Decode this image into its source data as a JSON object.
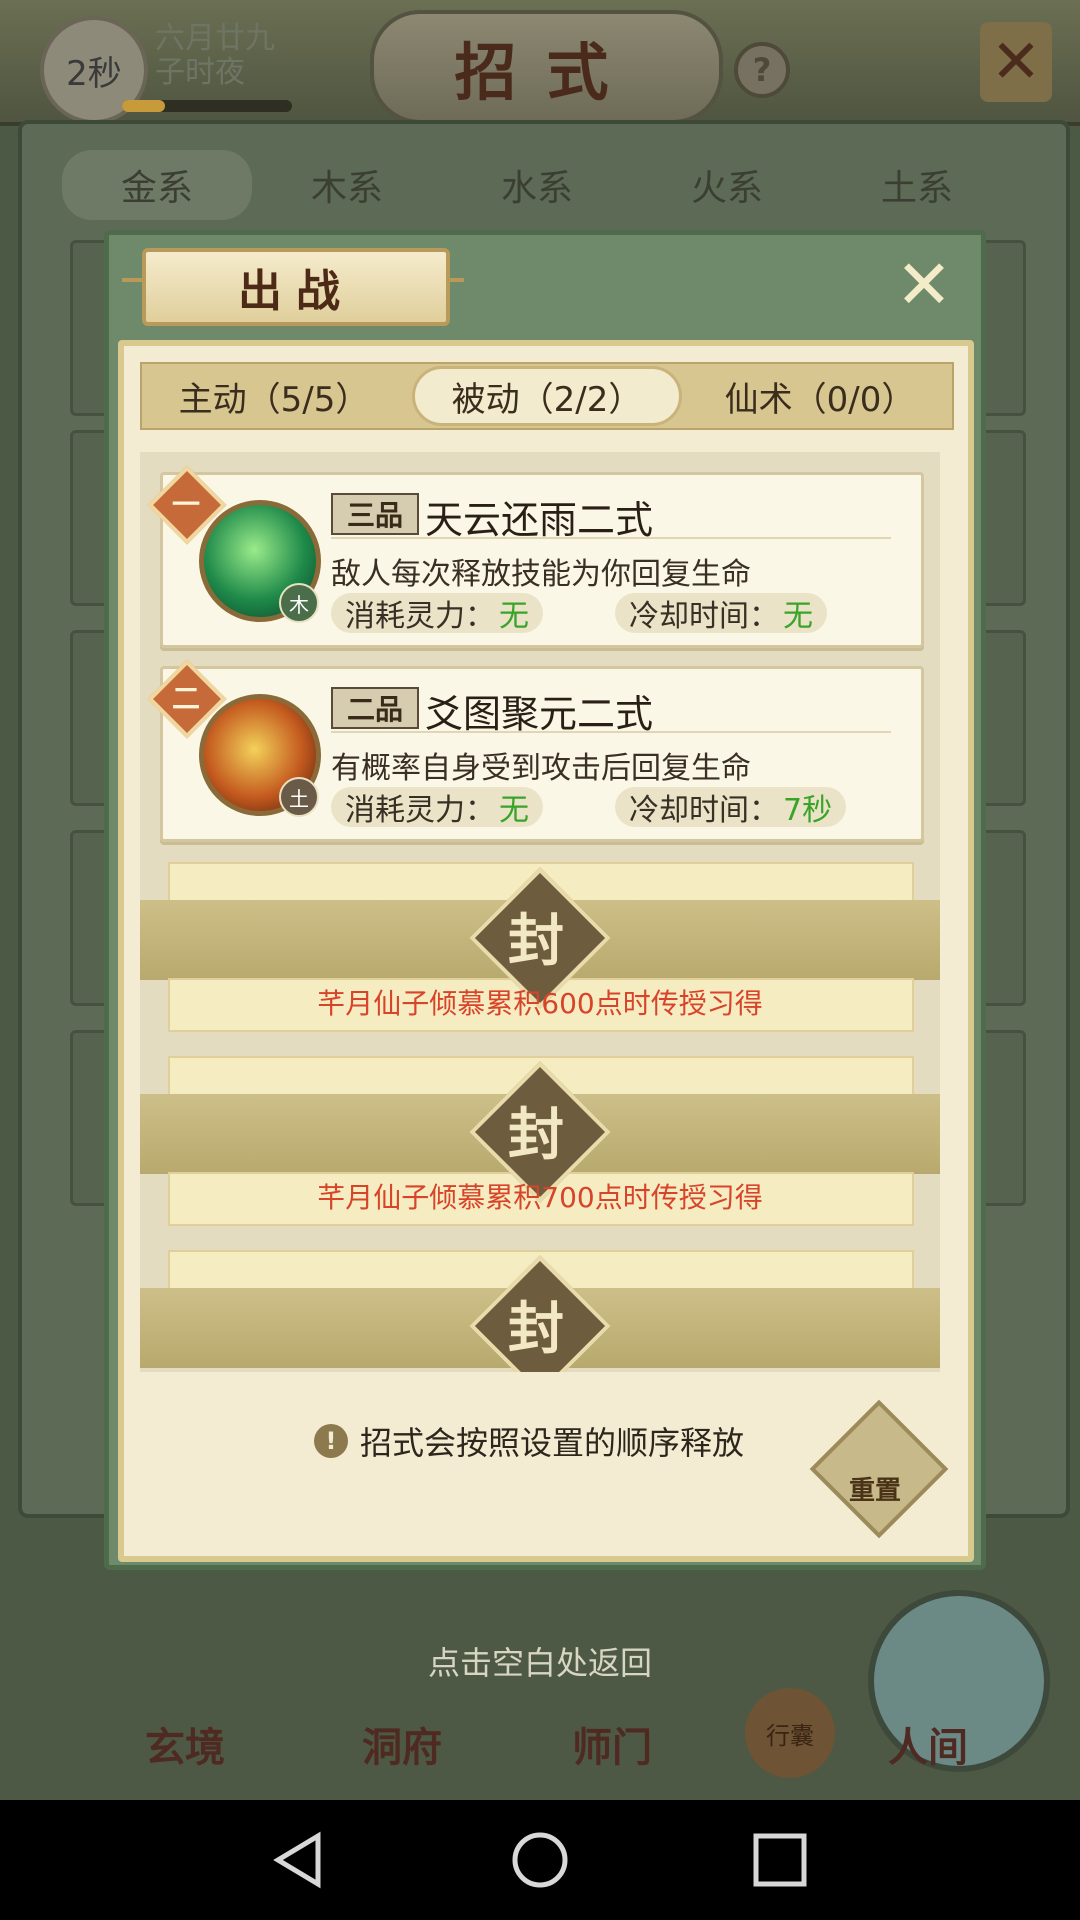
{
  "status": {
    "timer": "2秒",
    "date_line1": "六月廿九",
    "date_line2": "子时夜",
    "energy_fraction": 0.25
  },
  "header": {
    "title": "招式",
    "help_symbol": "?",
    "close_symbol": "✕"
  },
  "element_tabs": [
    "金系",
    "木系",
    "水系",
    "火系",
    "土系"
  ],
  "popup": {
    "title": "出战",
    "close_symbol": "✕",
    "tabs": [
      {
        "label": "主动（5/5）",
        "active": false
      },
      {
        "label": "被动（2/2）",
        "active": true
      },
      {
        "label": "仙术（0/0）",
        "active": false
      }
    ],
    "skills": [
      {
        "order": "一",
        "grade": "三品",
        "name": "天云还雨二式",
        "element": "木",
        "icon": "wood-scroll-icon",
        "description": "敌人每次释放技能为你回复生命",
        "cost_label": "消耗灵力：",
        "cost_value": "无",
        "cooldown_label": "冷却时间：",
        "cooldown_value": "无"
      },
      {
        "order": "二",
        "grade": "二品",
        "name": "爻图聚元二式",
        "element": "土",
        "icon": "earth-bowl-icon",
        "description": "有概率自身受到攻击后回复生命",
        "cost_label": "消耗灵力：",
        "cost_value": "无",
        "cooldown_label": "冷却时间：",
        "cooldown_value": "7秒"
      }
    ],
    "locked_slots": [
      {
        "seal": "封",
        "text": "芊月仙子倾慕累积600点时传授习得"
      },
      {
        "seal": "封",
        "text": "芊月仙子倾慕累积700点时传授习得"
      },
      {
        "seal": "封",
        "text": ""
      }
    ],
    "hint": "招式会按照设置的顺序释放",
    "hint_symbol": "!",
    "reset_label": "重置"
  },
  "return_hint": "点击空白处返回",
  "bottom_nav": {
    "items": [
      "玄境",
      "洞府",
      "师门"
    ],
    "bag": "行囊",
    "world": "人间"
  },
  "colors": {
    "accent_green": "#3aa32a",
    "unlock_red": "#d8442a",
    "popup_frame": "#6e8a6a",
    "parchment": "#f3ecd2"
  }
}
